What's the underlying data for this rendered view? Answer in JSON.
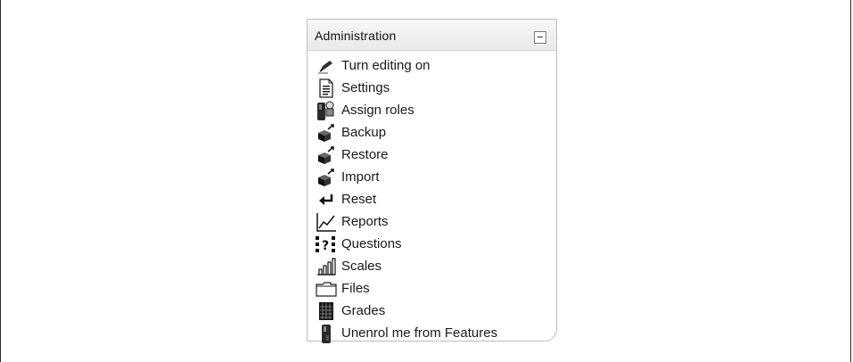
{
  "block": {
    "title": "Administration",
    "items": [
      {
        "label": "Turn editing on",
        "icon": "edit-icon"
      },
      {
        "label": "Settings",
        "icon": "settings-icon"
      },
      {
        "label": "Assign roles",
        "icon": "roles-icon"
      },
      {
        "label": "Backup",
        "icon": "backup-icon"
      },
      {
        "label": "Restore",
        "icon": "restore-icon"
      },
      {
        "label": "Import",
        "icon": "import-icon"
      },
      {
        "label": "Reset",
        "icon": "reset-icon"
      },
      {
        "label": "Reports",
        "icon": "reports-icon"
      },
      {
        "label": "Questions",
        "icon": "questions-icon"
      },
      {
        "label": "Scales",
        "icon": "scales-icon"
      },
      {
        "label": "Files",
        "icon": "folder-icon"
      },
      {
        "label": "Grades",
        "icon": "grades-icon"
      },
      {
        "label": "Unenrol me from Features",
        "icon": "unenrol-icon"
      }
    ]
  }
}
